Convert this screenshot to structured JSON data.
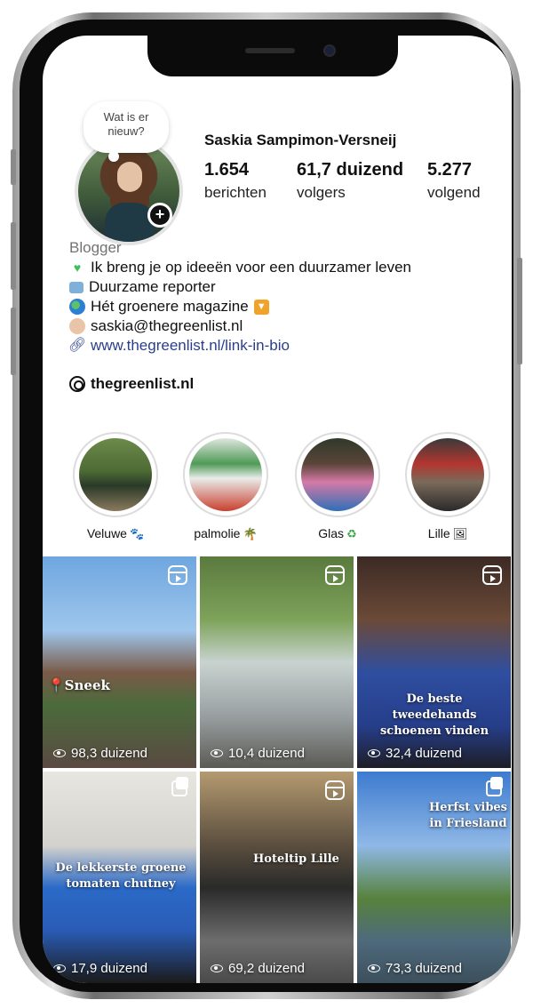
{
  "profile": {
    "note": [
      "Wat is er",
      "nieuw?"
    ],
    "username": "Saskia Sampimon-Versneij",
    "stats": [
      {
        "num": "1.654",
        "label": "berichten"
      },
      {
        "num": "61,7 duizend",
        "label": "volgers"
      },
      {
        "num": "5.277",
        "label": "volgend"
      }
    ],
    "category": "Blogger",
    "bio": [
      {
        "icon": "green-heart-icon",
        "text": "Ik breng je op ideeën voor een duurzamer leven"
      },
      {
        "icon": "tv-icon",
        "text": "Duurzame reporter"
      },
      {
        "icon": "globe-icon",
        "text": "Hét groenere magazine"
      },
      {
        "icon": "woman-icon",
        "text": "saskia@thegreenlist.nl"
      }
    ],
    "link": "www.thegreenlist.nl/link-in-bio",
    "threads": "thegreenlist.nl"
  },
  "highlights": [
    {
      "label": "Veluwe",
      "emoji": "🐾"
    },
    {
      "label": "palmolie",
      "emoji": "🌴"
    },
    {
      "label": "Glas",
      "emoji": "♻"
    },
    {
      "label": "Lille",
      "emoji": "🖼"
    }
  ],
  "posts": [
    {
      "caption": "📍Sneek",
      "views": "98,3 duizend",
      "type": "reel"
    },
    {
      "caption": "",
      "views": "10,4 duizend",
      "type": "reel"
    },
    {
      "caption": "De beste tweedehands schoenen vinden",
      "views": "32,4 duizend",
      "type": "reel"
    },
    {
      "caption": "De lekkerste groene tomaten chutney",
      "views": "17,9 duizend",
      "type": "carousel"
    },
    {
      "caption": "Hoteltip Lille",
      "views": "69,2 duizend",
      "type": "reel"
    },
    {
      "caption": "Herfst vibes in Friesland",
      "views": "73,3 duizend",
      "type": "carousel"
    }
  ]
}
